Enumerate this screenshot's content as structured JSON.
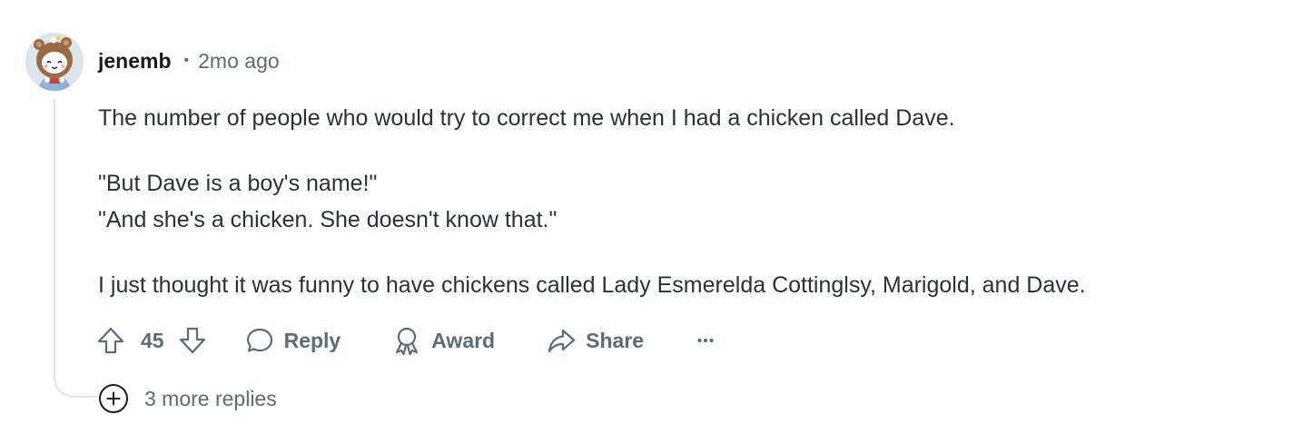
{
  "comment": {
    "author": "jenemb",
    "separator": "•",
    "time_ago": "2mo ago",
    "paragraphs": [
      "The number of people who would try to correct me when I had a chicken called Dave.",
      "\"But Dave is a boy's name!\"",
      "\"And she's a chicken. She doesn't know that.\"",
      "I just thought it was funny to have chickens called Lady Esmerelda Cottinglsy, Marigold, and Dave."
    ],
    "actions": {
      "upvote_icon": "arrow-up-icon",
      "score": "45",
      "downvote_icon": "arrow-down-icon",
      "reply_icon": "speech-bubble-icon",
      "reply_label": "Reply",
      "award_icon": "award-ribbon-icon",
      "award_label": "Award",
      "share_icon": "share-arrow-icon",
      "share_label": "Share",
      "more_icon": "ellipsis-icon"
    },
    "more_replies": {
      "icon": "plus-circle-icon",
      "label": "3 more replies"
    }
  },
  "colors": {
    "text_primary": "#1a1a1b",
    "text_secondary": "#5c6c74",
    "thread_line": "#e1e5e8"
  }
}
